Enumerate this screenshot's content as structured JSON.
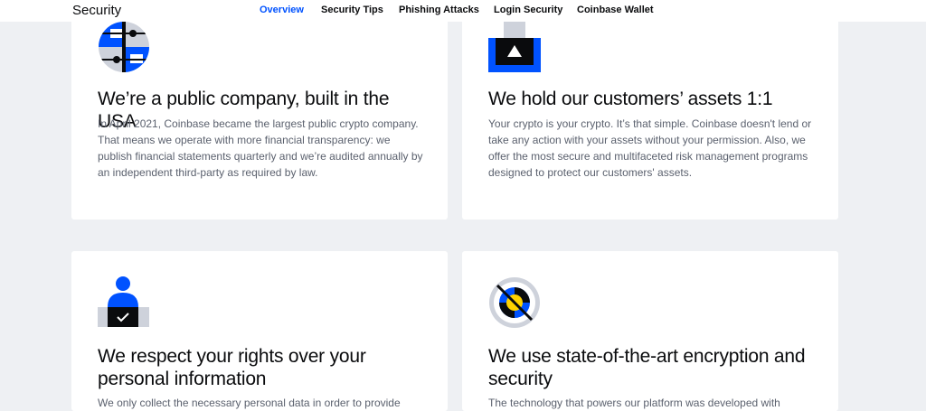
{
  "header": {
    "brand": "Security",
    "nav": [
      {
        "label": "Overview",
        "active": true
      },
      {
        "label": "Security Tips",
        "active": false
      },
      {
        "label": "Phishing Attacks",
        "active": false
      },
      {
        "label": "Login Security",
        "active": false
      },
      {
        "label": "Coinbase Wallet",
        "active": false
      }
    ]
  },
  "cards": [
    {
      "icon": "public-company-icon",
      "title": "We’re a public company, built in the USA",
      "body": "In April 2021, Coinbase became the largest public crypto company. That means we operate with more financial transparency: we publish financial statements quarterly and we’re audited annually by an independent third-party as required by law."
    },
    {
      "icon": "vault-icon",
      "title": "We hold our customers’ assets 1:1",
      "body": "Your crypto is your crypto. It’s that simple. Coinbase doesn't lend or take any action with your assets without your permission. Also, we offer the most secure and multifaceted risk management programs designed to protect our customers' assets."
    },
    {
      "icon": "person-check-icon",
      "title": "We respect your rights over your personal information",
      "body": "We only collect the necessary personal data in order to provide"
    },
    {
      "icon": "encryption-icon",
      "title": "We use state-of-the-art encryption and security",
      "body": "The technology that powers our platform was developed with"
    }
  ],
  "colors": {
    "accent": "#0052ff",
    "background": "#eef0f3",
    "card": "#ffffff",
    "body_text": "#5b616e",
    "illustration_gray": "#ced2db",
    "illustration_yellow": "#ffd200"
  }
}
